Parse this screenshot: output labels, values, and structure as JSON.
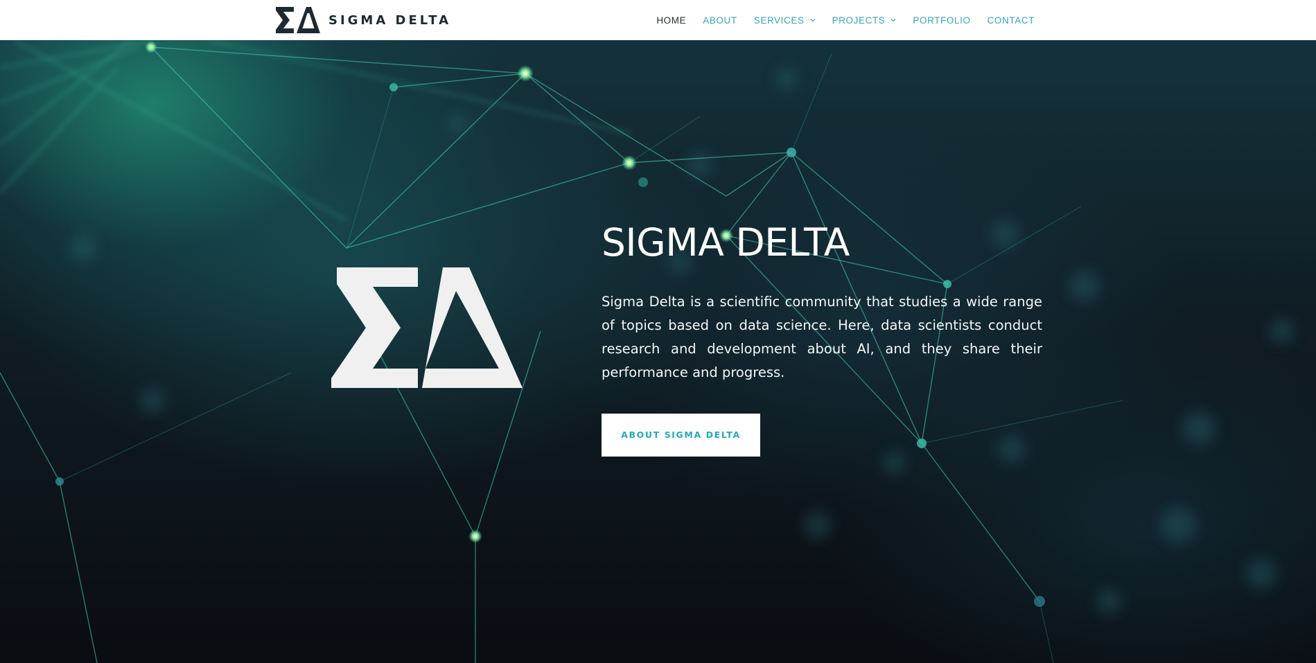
{
  "brand": {
    "name": "SIGMA DELTA",
    "logo_glyphs": "ΣΔ"
  },
  "nav": {
    "items": [
      {
        "label": "HOME",
        "active": true,
        "has_dropdown": false
      },
      {
        "label": "ABOUT",
        "active": false,
        "has_dropdown": false
      },
      {
        "label": "SERVICES",
        "active": false,
        "has_dropdown": true
      },
      {
        "label": "PROJECTS",
        "active": false,
        "has_dropdown": true
      },
      {
        "label": "PORTFOLIO",
        "active": false,
        "has_dropdown": false
      },
      {
        "label": "CONTACT",
        "active": false,
        "has_dropdown": false
      }
    ]
  },
  "hero": {
    "logo_glyphs": "ΣΔ",
    "title": "SIGMA DELTA",
    "description": "Sigma Delta is a scientific community that studies a wide range of topics based on data science. Here, data scientists conduct research and development about AI, and they share their performance and progress.",
    "button_label": "ABOUT SIGMA DELTA"
  },
  "colors": {
    "accent": "#3aa3b3",
    "button_text": "#2aa6b8",
    "active_nav": "#2a2f33",
    "logo_dark": "#1f2a30",
    "hero_background": "#0b0f14",
    "network_glow": "#9df0b8"
  }
}
